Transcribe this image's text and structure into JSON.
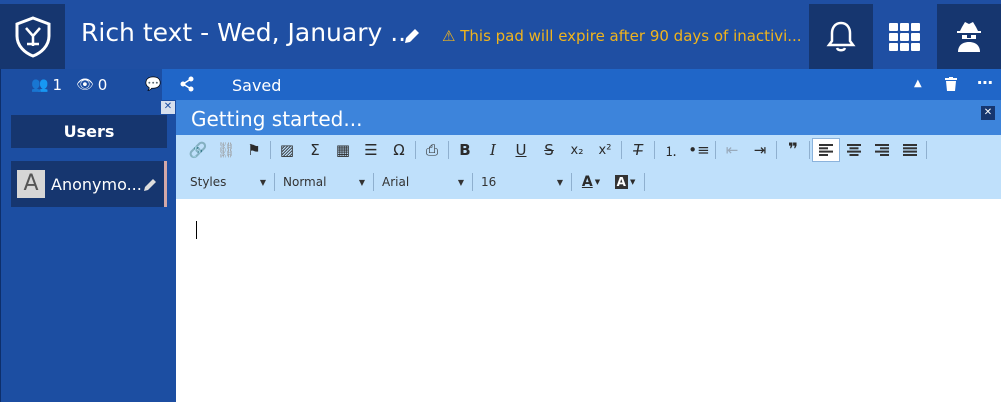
{
  "header": {
    "title": "Rich text - Wed, January ...",
    "warning": "This pad will expire after 90 days of inactivi..."
  },
  "sidebar": {
    "user_count": "1",
    "viewer_count": "0",
    "users_heading": "Users",
    "users": [
      {
        "avatar_letter": "A",
        "name": "Anonymo..."
      }
    ]
  },
  "mainbar": {
    "status": "Saved"
  },
  "panel": {
    "title": "Getting started..."
  },
  "toolbar": {
    "row1": [
      "link-icon",
      "unlink-icon",
      "flag-icon",
      "image-icon",
      "sigma-icon",
      "table-icon",
      "hline-icon",
      "omega-icon",
      "print-icon",
      "bold-icon",
      "italic-icon",
      "underline-icon",
      "strike-icon",
      "subscript-icon",
      "superscript-icon",
      "clear-format-icon",
      "ordered-list-icon",
      "bullet-list-icon",
      "outdent-icon",
      "indent-icon",
      "quote-icon",
      "align-left-icon",
      "align-center-icon",
      "align-right-icon",
      "justify-icon"
    ],
    "styles": "Styles",
    "format": "Normal",
    "font": "Arial",
    "size": "16"
  },
  "colors": {
    "header_bg": "#1f4fa3",
    "dark": "#16366f",
    "warning": "#f1b41c",
    "toolbar_bg": "#bfe0fb"
  }
}
